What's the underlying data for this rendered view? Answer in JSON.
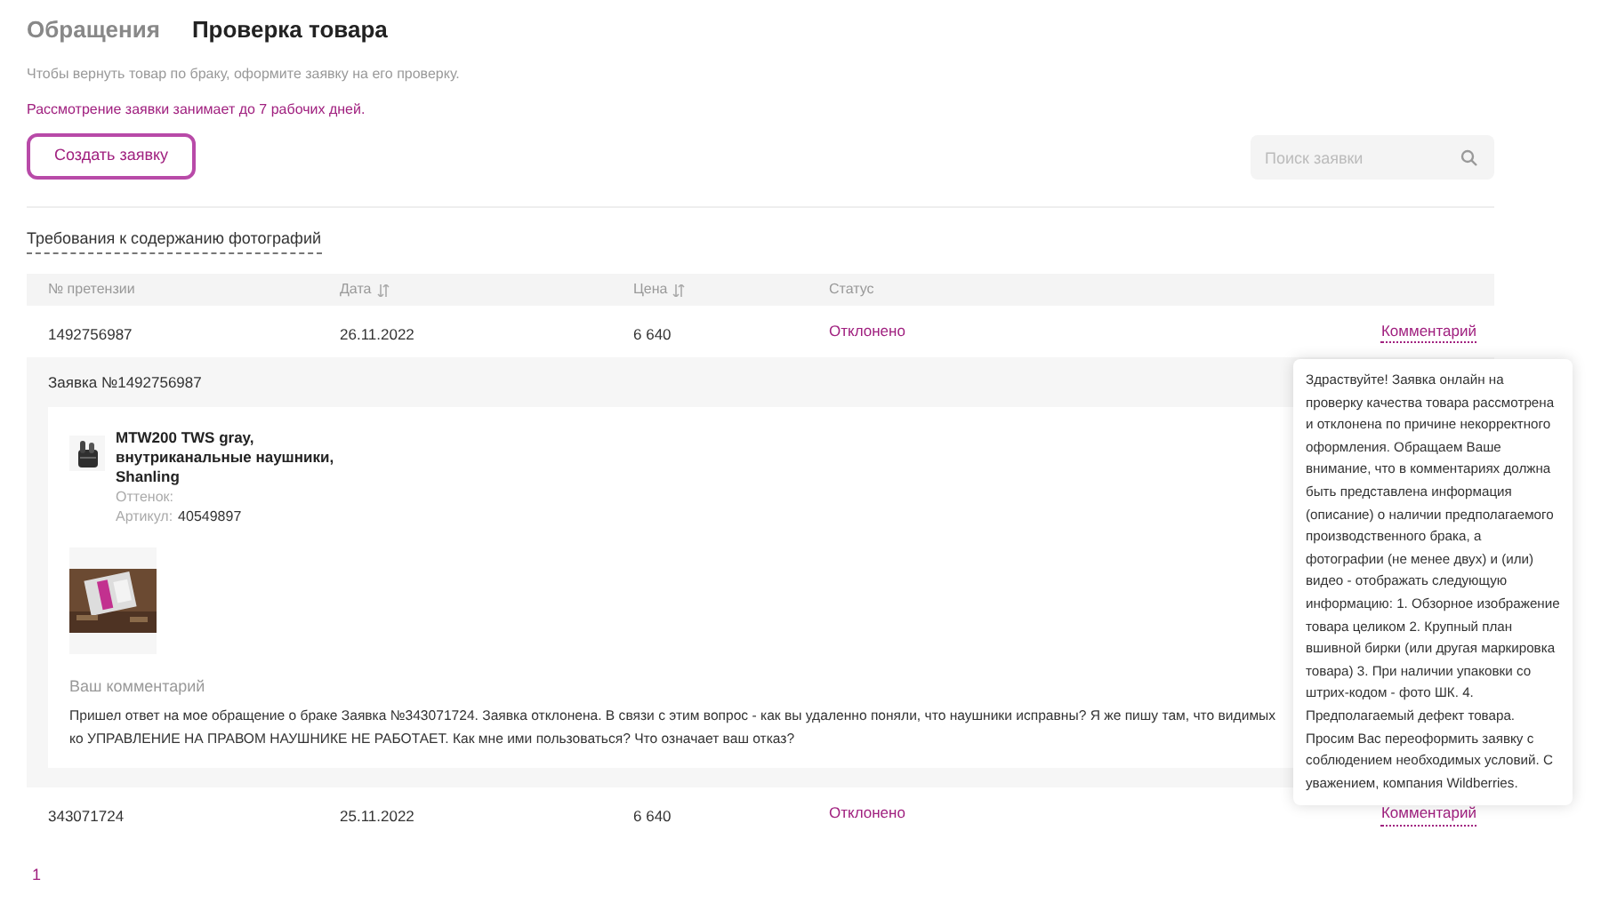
{
  "tabs": [
    {
      "label": "Обращения",
      "selected": false
    },
    {
      "label": "Проверка товара",
      "selected": true
    }
  ],
  "intro": "Чтобы вернуть товар по браку, оформите заявку на его проверку.",
  "notice": "Рассмотрение заявки занимает до 7 рабочих дней.",
  "create_button": "Создать заявку",
  "search": {
    "placeholder": "Поиск заявки"
  },
  "photo_requirements_link": "Требования к содержанию фотографий",
  "table": {
    "columns": [
      {
        "label": "№ претензии",
        "sortable": false
      },
      {
        "label": "Дата",
        "sortable": true
      },
      {
        "label": "Цена",
        "sortable": true
      },
      {
        "label": "Статус",
        "sortable": false
      }
    ],
    "rows": [
      {
        "number": "1492756987",
        "date": "26.11.2022",
        "price": "6 640",
        "status": "Отклонено",
        "comment_link": "Комментарий",
        "details": {
          "title": "Заявка №1492756987",
          "product_name": "MTW200 TWS gray, внутриканальные наушники, Shanling",
          "shade_label": "Оттенок:",
          "article_label": "Артикул:",
          "article": "40549897",
          "comment_label": "Ваш комментарий",
          "comment_lines": [
            "Пришел ответ на мое обращение о браке Заявка №343071724. Заявка отклонена. В связи с этим вопрос - как вы удаленно поняли, что наушники исправны? Я же пишу там, что видимых",
            "ко УПРАВЛЕНИЕ НА ПРАВОМ НАУШНИКЕ НЕ РАБОТАЕТ. Как мне ими пользоваться? Что означает ваш отказ?"
          ]
        }
      },
      {
        "number": "343071724",
        "date": "25.11.2022",
        "price": "6 640",
        "status": "Отклонено",
        "comment_link": "Комментарий"
      }
    ]
  },
  "tooltip": "Здраствуйте! Заявка онлайн на проверку качества товара рассмотрена и отклонена по причине некорректного оформления. Обращаем Ваше внимание, что в комментариях должна быть представлена информация (описание) о наличии предполагаемого производственного брака, а фотографии (не менее двух) и (или) видео - отображать следующую информацию: 1. Обзорное изображение товара целиком 2. Крупный план вшивной бирки (или другая маркировка товара) 3. При наличии упаковки со штрих-кодом - фото ШК. 4. Предполагаемый дефект товара. Просим Вас переоформить заявку с соблюдением необходимых условий. С уважением, компания Wildberries.",
  "pagination": [
    {
      "label": "1",
      "selected": true
    }
  ]
}
